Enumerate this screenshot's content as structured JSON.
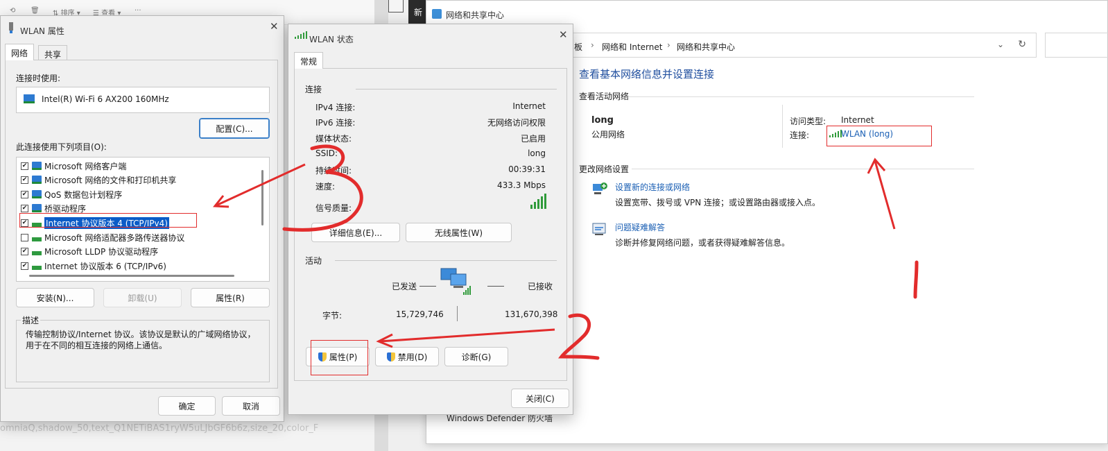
{
  "background": {
    "toolbar": {
      "sort_label": "排序",
      "view_label": "查看",
      "more_label": "···"
    },
    "left_footer_text": "omniaQ,shadow_50,text_Q1NETiBAS1ryW5uLJbGF6b6z,size_20,color_F",
    "new_tab_label": "新",
    "defender_label": "Windows Defender 防火墙"
  },
  "network_center": {
    "title": "网络和共享中心",
    "breadcrumb": [
      "板",
      "网络和 Internet",
      "网络和共享中心"
    ],
    "heading": "查看基本网络信息并设置连接",
    "active_section": "查看活动网络",
    "network_name": "long",
    "network_type": "公用网络",
    "access_type_label": "访问类型:",
    "access_type_value": "Internet",
    "connection_label": "连接:",
    "connection_link": "WLAN (long)",
    "change_section": "更改网络设置",
    "setup_link": "设置新的连接或网络",
    "setup_desc": "设置宽带、拨号或 VPN 连接；或设置路由器或接入点。",
    "troubleshoot_link": "问题疑难解答",
    "troubleshoot_desc": "诊断并修复网络问题，或者获得疑难解答信息。"
  },
  "wlan_properties": {
    "title": "WLAN 属性",
    "tabs": [
      "网络",
      "共享"
    ],
    "connect_using_label": "连接时使用:",
    "adapter": "Intel(R) Wi-Fi 6 AX200 160MHz",
    "configure_button": "配置(C)...",
    "items_label": "此连接使用下列项目(O):",
    "items": [
      {
        "label": "Microsoft 网络客户端",
        "checked": true
      },
      {
        "label": "Microsoft 网络的文件和打印机共享",
        "checked": true
      },
      {
        "label": "QoS 数据包计划程序",
        "checked": true
      },
      {
        "label": "桥驱动程序",
        "checked": true
      },
      {
        "label": "Internet 协议版本 4 (TCP/IPv4)",
        "checked": true
      },
      {
        "label": "Microsoft 网络适配器多路传送器协议",
        "checked": false
      },
      {
        "label": "Microsoft LLDP 协议驱动程序",
        "checked": true
      },
      {
        "label": "Internet 协议版本 6 (TCP/IPv6)",
        "checked": true
      }
    ],
    "install_button": "安装(N)...",
    "uninstall_button": "卸载(U)",
    "properties_button": "属性(R)",
    "description_label": "描述",
    "description_text": "传输控制协议/Internet 协议。该协议是默认的广域网络协议，用于在不同的相互连接的网络上通信。",
    "ok_button": "确定",
    "cancel_button": "取消"
  },
  "wlan_status": {
    "title": "WLAN 状态",
    "tab": "常规",
    "connection_group": "连接",
    "rows": [
      {
        "label": "IPv4 连接:",
        "value": "Internet"
      },
      {
        "label": "IPv6 连接:",
        "value": "无网络访问权限"
      },
      {
        "label": "媒体状态:",
        "value": "已启用"
      },
      {
        "label": "SSID:",
        "value": "long"
      },
      {
        "label": "持续时间:",
        "value": "00:39:31"
      },
      {
        "label": "速度:",
        "value": "433.3 Mbps"
      }
    ],
    "signal_label": "信号质量:",
    "details_button": "详细信息(E)...",
    "wireless_props_button": "无线属性(W)",
    "activity_group": "活动",
    "sent_label": "已发送",
    "received_label": "已接收",
    "bytes_label": "字节:",
    "bytes_sent": "15,729,746",
    "bytes_received": "131,670,398",
    "properties_button": "属性(P)",
    "disable_button": "禁用(D)",
    "diagnose_button": "诊断(G)",
    "close_button": "关闭(C)"
  },
  "annotations": [
    "1",
    "2",
    "3"
  ],
  "colors": {
    "accent": "#1a5fb4",
    "annotation": "#e22c2c",
    "signal": "#2f9a3a"
  }
}
